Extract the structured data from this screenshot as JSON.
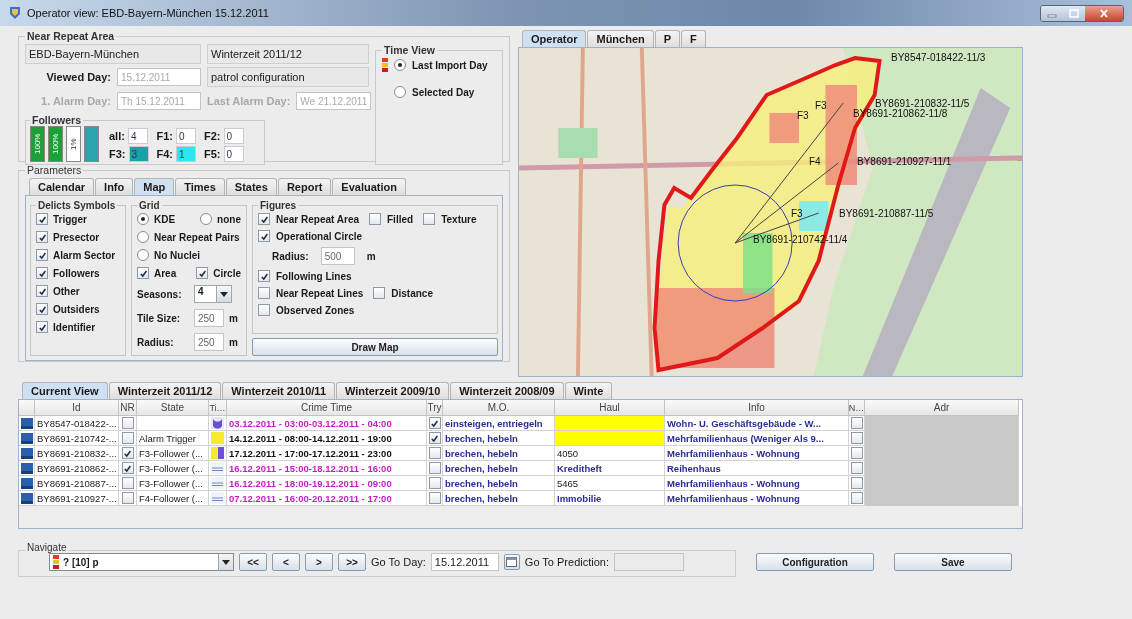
{
  "window": {
    "title": "Operator view: EBD-Bayern-München 15.12.2011"
  },
  "near_repeat_area": {
    "title": "Near Repeat Area",
    "area": "EBD-Bayern-München",
    "season": "Winterzeit 2011/12",
    "configuration": "patrol configuration",
    "fields": [
      {
        "label": "Viewed Day:",
        "value": "15.12.2011",
        "disabled": false
      },
      {
        "label": "1. Alarm Day:",
        "value": "Th 15.12.2011",
        "disabled": true
      },
      {
        "label": "Last Alarm Day:",
        "value": "We 21.12.2011",
        "disabled": true
      }
    ],
    "followers": {
      "title": "Followers",
      "bars": [
        {
          "label": "100%",
          "color": "#1f9e3a"
        },
        {
          "label": "100%",
          "color": "#1f9e3a"
        },
        {
          "label": "1%",
          "color": "#ffffff"
        },
        {
          "color": "#2aa5ad"
        }
      ],
      "counts": [
        {
          "label": "all:",
          "value": "4",
          "color": "#ffffff"
        },
        {
          "label": "F1:",
          "value": "0",
          "color": "#ffffff"
        },
        {
          "label": "F2:",
          "value": "0",
          "color": "#ffffff"
        },
        {
          "label": "F3:",
          "value": "3",
          "color": "#17a2a8"
        },
        {
          "label": "F4:",
          "value": "1",
          "color": "#29e6f2"
        },
        {
          "label": "F5:",
          "value": "0",
          "color": "#ffffff"
        }
      ]
    },
    "time_view": {
      "title": "Time View",
      "options": [
        {
          "label": "Last Import Day",
          "selected": true
        },
        {
          "label": "Selected Day",
          "selected": false
        }
      ]
    }
  },
  "parameters": {
    "title": "Parameters",
    "tabs": [
      {
        "label": "Calendar",
        "selected": false
      },
      {
        "label": "Info",
        "selected": false
      },
      {
        "label": "Map",
        "selected": true
      },
      {
        "label": "Times",
        "selected": false
      },
      {
        "label": "States",
        "selected": false
      },
      {
        "label": "Report",
        "selected": false
      },
      {
        "label": "Evaluation",
        "selected": false
      }
    ],
    "delicts": {
      "title": "Delicts Symbols",
      "items": [
        {
          "label": "Trigger",
          "checked": true
        },
        {
          "label": "Presector",
          "checked": true
        },
        {
          "label": "Alarm Sector",
          "checked": true
        },
        {
          "label": "Followers",
          "checked": true
        },
        {
          "label": "Other",
          "checked": true
        },
        {
          "label": "Outsiders",
          "checked": true
        },
        {
          "label": "Identifier",
          "checked": true
        }
      ]
    },
    "grid": {
      "title": "Grid",
      "options": [
        {
          "label": "KDE",
          "selected": true
        },
        {
          "label": "none",
          "selected": false
        },
        {
          "label": "Near Repeat Pairs",
          "selected": false
        },
        {
          "label": "No Nuclei",
          "selected": false
        }
      ],
      "checks": [
        {
          "label": "Area",
          "checked": true
        },
        {
          "label": "Circle",
          "checked": true
        }
      ],
      "seasons": {
        "label": "Seasons:",
        "value": "4"
      },
      "tile_size": {
        "label": "Tile Size:",
        "value": "250",
        "unit": "m"
      },
      "radius": {
        "label": "Radius:",
        "value": "250",
        "unit": "m"
      }
    },
    "figures": {
      "title": "Figures",
      "rows": [
        {
          "items": [
            {
              "kind": "checkbox",
              "label": "Near Repeat Area",
              "checked": true
            },
            {
              "kind": "checkbox",
              "label": "Filled",
              "checked": false
            },
            {
              "kind": "checkbox",
              "label": "Texture",
              "checked": false
            }
          ]
        },
        {
          "items": [
            {
              "kind": "checkbox",
              "label": "Operational Circle",
              "checked": true
            }
          ]
        },
        {
          "items": [
            {
              "kind": "field",
              "label": "Radius:",
              "value": "500",
              "unit": "m"
            }
          ]
        },
        {
          "items": [
            {
              "kind": "checkbox",
              "label": "Following Lines",
              "checked": true
            }
          ]
        },
        {
          "items": [
            {
              "kind": "checkbox",
              "label": "Near Repeat Lines",
              "checked": false
            },
            {
              "kind": "checkbox",
              "label": "Distance",
              "checked": false
            }
          ]
        },
        {
          "items": [
            {
              "kind": "checkbox",
              "label": "Observed Zones",
              "checked": false
            }
          ]
        }
      ]
    },
    "draw_button": "Draw Map"
  },
  "map": {
    "tabs": [
      {
        "label": "Operator",
        "selected": true
      },
      {
        "label": "München",
        "selected": false
      },
      {
        "label": "P",
        "selected": false
      },
      {
        "label": "F",
        "selected": false
      }
    ],
    "labels": [
      "BY8547-018422-11/3",
      "F3",
      "BY8691-210832-11/5",
      "F3",
      "BY8691-210862-11/8",
      "F4",
      "BY8691-210927-11/1",
      "F3",
      "BY8691-210887-11/5",
      "BY8691-210742-11/4"
    ]
  },
  "table": {
    "tabs": [
      {
        "label": "Current View",
        "selected": true
      },
      {
        "label": "Winterzeit 2011/12",
        "selected": false
      },
      {
        "label": "Winterzeit 2010/11",
        "selected": false
      },
      {
        "label": "Winterzeit 2009/10",
        "selected": false
      },
      {
        "label": "Winterzeit 2008/09",
        "selected": false
      },
      {
        "label": "Winte",
        "selected": false
      }
    ],
    "columns": [
      "Id",
      "NR",
      "State",
      "Ti…",
      "Crime Time",
      "Try",
      "M.O.",
      "Haul",
      "Info",
      "N…",
      "Adr"
    ],
    "rows": [
      {
        "id": "BY8547-018422-...",
        "nr": false,
        "time_icon": {
          "kind": "half-circle"
        },
        "crime_time": {
          "text": "03.12.2011 - 03:00-03.12.2011 - 04:00",
          "color": "#c21fc2"
        },
        "try": true,
        "mo": "einsteigen, entriegeln",
        "haul": {
          "kind": "missing"
        },
        "info": "Wohn- U. Geschäftsgebäude - W...",
        "n": false
      },
      {
        "id": "BY8691-210742-...",
        "nr": false,
        "state": "Alarm Trigger",
        "time_icon": {
          "kind": "square"
        },
        "crime_time": {
          "text": "14.12.2011 - 08:00-14.12.2011 - 19:00",
          "color": "#111111"
        },
        "try": true,
        "mo": "brechen, hebeln",
        "haul": {
          "kind": "missing"
        },
        "info": "Mehrfamilienhaus (Weniger Als 9...",
        "n": false
      },
      {
        "id": "BY8691-210832-...",
        "nr": true,
        "state": "F3-Follower (...",
        "time_icon": {
          "kind": "split"
        },
        "crime_time": {
          "text": "17.12.2011 - 17:00-17.12.2011 - 23:00",
          "color": "#111111"
        },
        "try": false,
        "mo": "brechen, hebeln",
        "haul": {
          "kind": "number",
          "text": "4050"
        },
        "info": "Mehrfamilienhaus - Wohnung",
        "n": false
      },
      {
        "id": "BY8691-210862-...",
        "nr": true,
        "state": "F3-Follower (...",
        "time_icon": {
          "kind": "lines"
        },
        "crime_time": {
          "text": "16.12.2011 - 15:00-18.12.2011 - 16:00",
          "color": "#c21fc2"
        },
        "try": false,
        "mo": "brechen, hebeln",
        "haul": {
          "kind": "item",
          "text": "Kreditheft"
        },
        "info": "Reihenhaus",
        "n": false
      },
      {
        "id": "BY8691-210887-...",
        "nr": false,
        "state": "F3-Follower (...",
        "time_icon": {
          "kind": "lines"
        },
        "crime_time": {
          "text": "16.12.2011 - 18:00-19.12.2011 - 09:00",
          "color": "#c21fc2"
        },
        "try": false,
        "mo": "brechen, hebeln",
        "haul": {
          "kind": "number",
          "text": "5465"
        },
        "info": "Mehrfamilienhaus - Wohnung",
        "n": false
      },
      {
        "id": "BY8691-210927-...",
        "nr": false,
        "state": "F4-Follower (...",
        "time_icon": {
          "kind": "lines"
        },
        "crime_time": {
          "text": "07.12.2011 - 16:00-20.12.2011 - 17:00",
          "color": "#c21fc2"
        },
        "try": false,
        "mo": "brechen, hebeln",
        "haul": {
          "kind": "item",
          "text": "Immobilie"
        },
        "info": "Mehrfamilienhaus - Wohnung",
        "n": false
      }
    ]
  },
  "navigate": {
    "title": "Navigate",
    "selection": "? [10] p",
    "buttons": [
      "<<",
      "<",
      ">",
      ">>"
    ],
    "go_to_day_label": "Go To Day:",
    "go_to_day": "15.12.2011",
    "go_to_prediction_label": "Go To Prediction:"
  },
  "actions": [
    "Configuration",
    "Save"
  ]
}
